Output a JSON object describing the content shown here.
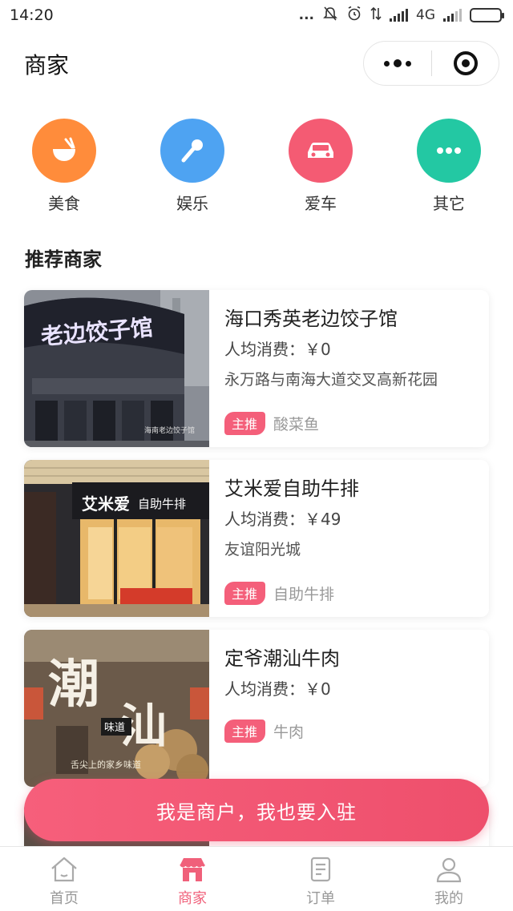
{
  "status": {
    "time": "14:20",
    "network": "4G",
    "dots": "..."
  },
  "nav": {
    "title": "商家"
  },
  "categories": [
    {
      "label": "美食",
      "icon": "bowl-icon",
      "color": "#ff8c3b"
    },
    {
      "label": "娱乐",
      "icon": "microphone-icon",
      "color": "#4ea3f2"
    },
    {
      "label": "爱车",
      "icon": "car-icon",
      "color": "#f45b73"
    },
    {
      "label": "其它",
      "icon": "more-dots-icon",
      "color": "#23c8a3"
    }
  ],
  "section_title": "推荐商家",
  "merchants": [
    {
      "name": "海口秀英老边饺子馆",
      "price": "人均消费：￥0",
      "address": "永万路与南海大道交叉高新花园",
      "tag": "主推",
      "dish": "酸菜鱼",
      "sign_text": "老边饺子馆",
      "watermark": "海南老边饺子馆"
    },
    {
      "name": "艾米爱自助牛排",
      "price": "人均消费：￥49",
      "address": "友谊阳光城",
      "tag": "主推",
      "dish": "自助牛排",
      "sign_text": "艾米爱",
      "sign_sub": "自助牛排"
    },
    {
      "name": "定爷潮汕牛肉",
      "price": "人均消费：￥0",
      "address": "",
      "tag": "主推",
      "dish": "牛肉",
      "sign_big1": "潮",
      "sign_big2": "汕",
      "sign_small": "味道",
      "sign_vertical": "舌尖上的家乡味道"
    }
  ],
  "cta": {
    "label": "我是商户，我也要入驻"
  },
  "tabbar": [
    {
      "label": "首页",
      "icon": "home-icon",
      "active": false
    },
    {
      "label": "商家",
      "icon": "shop-icon",
      "active": true
    },
    {
      "label": "订单",
      "icon": "order-icon",
      "active": false
    },
    {
      "label": "我的",
      "icon": "user-icon",
      "active": false
    }
  ],
  "colors": {
    "accent": "#f0607a",
    "tag": "#f45f7a",
    "inactive": "#999999"
  }
}
